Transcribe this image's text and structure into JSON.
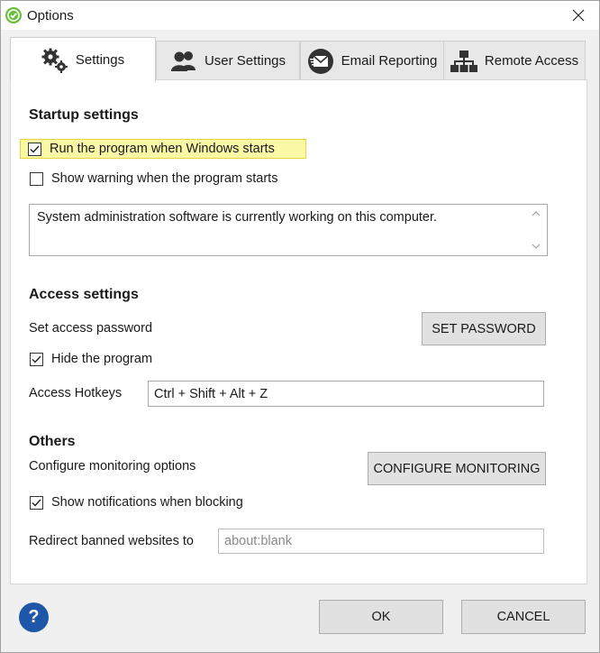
{
  "window": {
    "title": "Options"
  },
  "tabs": [
    {
      "label": "Settings",
      "icon": "gears-icon",
      "active": true
    },
    {
      "label": "User Settings",
      "icon": "users-icon"
    },
    {
      "label": "Email Reporting",
      "icon": "email-icon"
    },
    {
      "label": "Remote Access",
      "icon": "network-icon"
    }
  ],
  "startup": {
    "title": "Startup settings",
    "run_on_start": {
      "label": "Run the program when Windows starts",
      "checked": true
    },
    "show_warning": {
      "label": "Show warning when the program starts",
      "checked": false
    },
    "warning_text": "System administration software is currently working on this computer."
  },
  "access": {
    "title": "Access settings",
    "password_label": "Set access password",
    "set_password_button": "SET PASSWORD",
    "hide_program": {
      "label": "Hide the program",
      "checked": true
    },
    "hotkeys_label": "Access Hotkeys",
    "hotkeys_value": "Ctrl + Shift + Alt + Z"
  },
  "others": {
    "title": "Others",
    "monitoring_label": "Configure monitoring options",
    "configure_button": "CONFIGURE MONITORING",
    "show_notifications": {
      "label": "Show notifications when blocking",
      "checked": true
    },
    "redirect_label": "Redirect banned websites to",
    "redirect_value": "about:blank"
  },
  "footer": {
    "help": "?",
    "ok": "OK",
    "cancel": "CANCEL"
  },
  "colors": {
    "highlight": "#fbf8a6",
    "help_icon": "#1e57a7",
    "app_icon": "#6bbf3a"
  }
}
